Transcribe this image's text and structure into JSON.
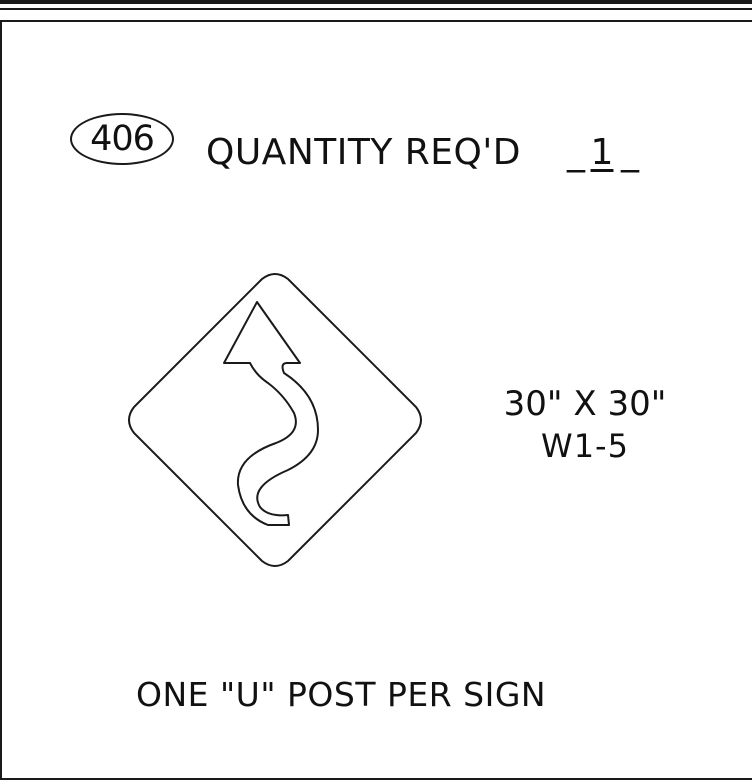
{
  "item_number": "406",
  "quantity": {
    "label": "QUANTITY REQ'D",
    "blank_left": "_",
    "value": "1",
    "blank_right": "_"
  },
  "sign": {
    "size": "30\" X 30\"",
    "code": "W1-5",
    "icon": "winding-road-diamond-icon"
  },
  "post_note": "ONE \"U\" POST PER SIGN"
}
